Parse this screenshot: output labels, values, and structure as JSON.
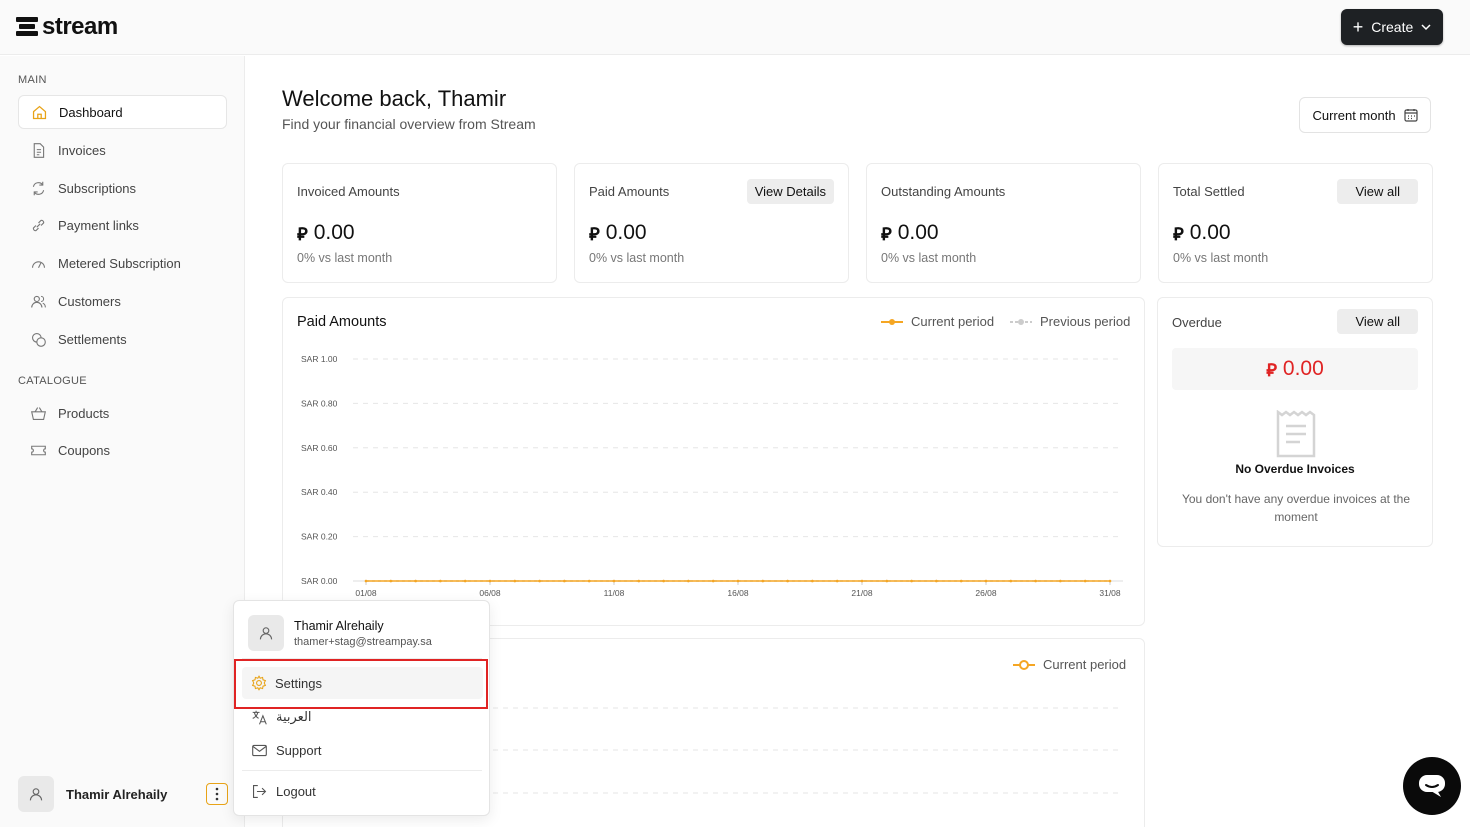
{
  "header": {
    "logo_text": "stream",
    "create_label": "Create"
  },
  "sidebar": {
    "main_label": "MAIN",
    "catalogue_label": "CATALOGUE",
    "items": [
      {
        "label": "Dashboard",
        "icon": "home-icon",
        "active": true
      },
      {
        "label": "Invoices",
        "icon": "invoice-icon"
      },
      {
        "label": "Subscriptions",
        "icon": "refresh-icon"
      },
      {
        "label": "Payment links",
        "icon": "link-icon"
      },
      {
        "label": "Metered Subscription",
        "icon": "gauge-icon"
      },
      {
        "label": "Customers",
        "icon": "users-icon"
      },
      {
        "label": "Settlements",
        "icon": "coins-icon"
      }
    ],
    "catalogue_items": [
      {
        "label": "Products",
        "icon": "basket-icon"
      },
      {
        "label": "Coupons",
        "icon": "ticket-icon"
      }
    ],
    "user_name": "Thamir Alrehaily"
  },
  "main": {
    "welcome": "Welcome back, Thamir",
    "subtitle": "Find your financial overview from Stream",
    "period_label": "Current month",
    "cards": [
      {
        "title": "Invoiced Amounts",
        "amount": "0.00",
        "delta": "0% vs last month",
        "button": ""
      },
      {
        "title": "Paid Amounts",
        "amount": "0.00",
        "delta": "0% vs last month",
        "button": "View Details"
      },
      {
        "title": "Outstanding Amounts",
        "amount": "0.00",
        "delta": "0% vs last month",
        "button": ""
      },
      {
        "title": "Total Settled",
        "amount": "0.00",
        "delta": "0% vs last month",
        "button": "View all"
      }
    ],
    "paid_chart": {
      "title": "Paid Amounts",
      "legend_current": "Current period",
      "legend_previous": "Previous period"
    },
    "second_chart": {
      "legend_current": "Current period"
    },
    "overdue": {
      "title": "Overdue",
      "button": "View all",
      "amount": "0.00",
      "empty_title": "No Overdue Invoices",
      "empty_desc": "You don't have any overdue invoices at the moment"
    }
  },
  "popup": {
    "name": "Thamir Alrehaily",
    "email": "thamer+stag@streampay.sa",
    "settings": "Settings",
    "language": "العربية",
    "support": "Support",
    "logout": "Logout"
  },
  "colors": {
    "accent": "#f5a623",
    "danger": "#e02424",
    "dark": "#1e2124"
  },
  "chart_data": {
    "type": "line",
    "title": "Paid Amounts",
    "x": [
      "01/08",
      "06/08",
      "11/08",
      "16/08",
      "21/08",
      "26/08",
      "31/08"
    ],
    "y_ticks": [
      "SAR 1.00",
      "SAR 0.80",
      "SAR 0.60",
      "SAR 0.40",
      "SAR 0.20",
      "SAR 0.00"
    ],
    "ylim": [
      0,
      1
    ],
    "series": [
      {
        "name": "Current period",
        "color": "#f5a623",
        "values": [
          0,
          0,
          0,
          0,
          0,
          0,
          0,
          0,
          0,
          0,
          0,
          0,
          0,
          0,
          0,
          0,
          0,
          0,
          0,
          0,
          0,
          0,
          0,
          0,
          0,
          0,
          0,
          0,
          0,
          0,
          0
        ]
      },
      {
        "name": "Previous period",
        "color": "#cccccc",
        "values": [
          0,
          0,
          0,
          0,
          0,
          0,
          0,
          0,
          0,
          0,
          0,
          0,
          0,
          0,
          0,
          0,
          0,
          0,
          0,
          0,
          0,
          0,
          0,
          0,
          0,
          0,
          0,
          0,
          0,
          0,
          0
        ]
      }
    ],
    "grid": true,
    "legend": "top-right"
  }
}
